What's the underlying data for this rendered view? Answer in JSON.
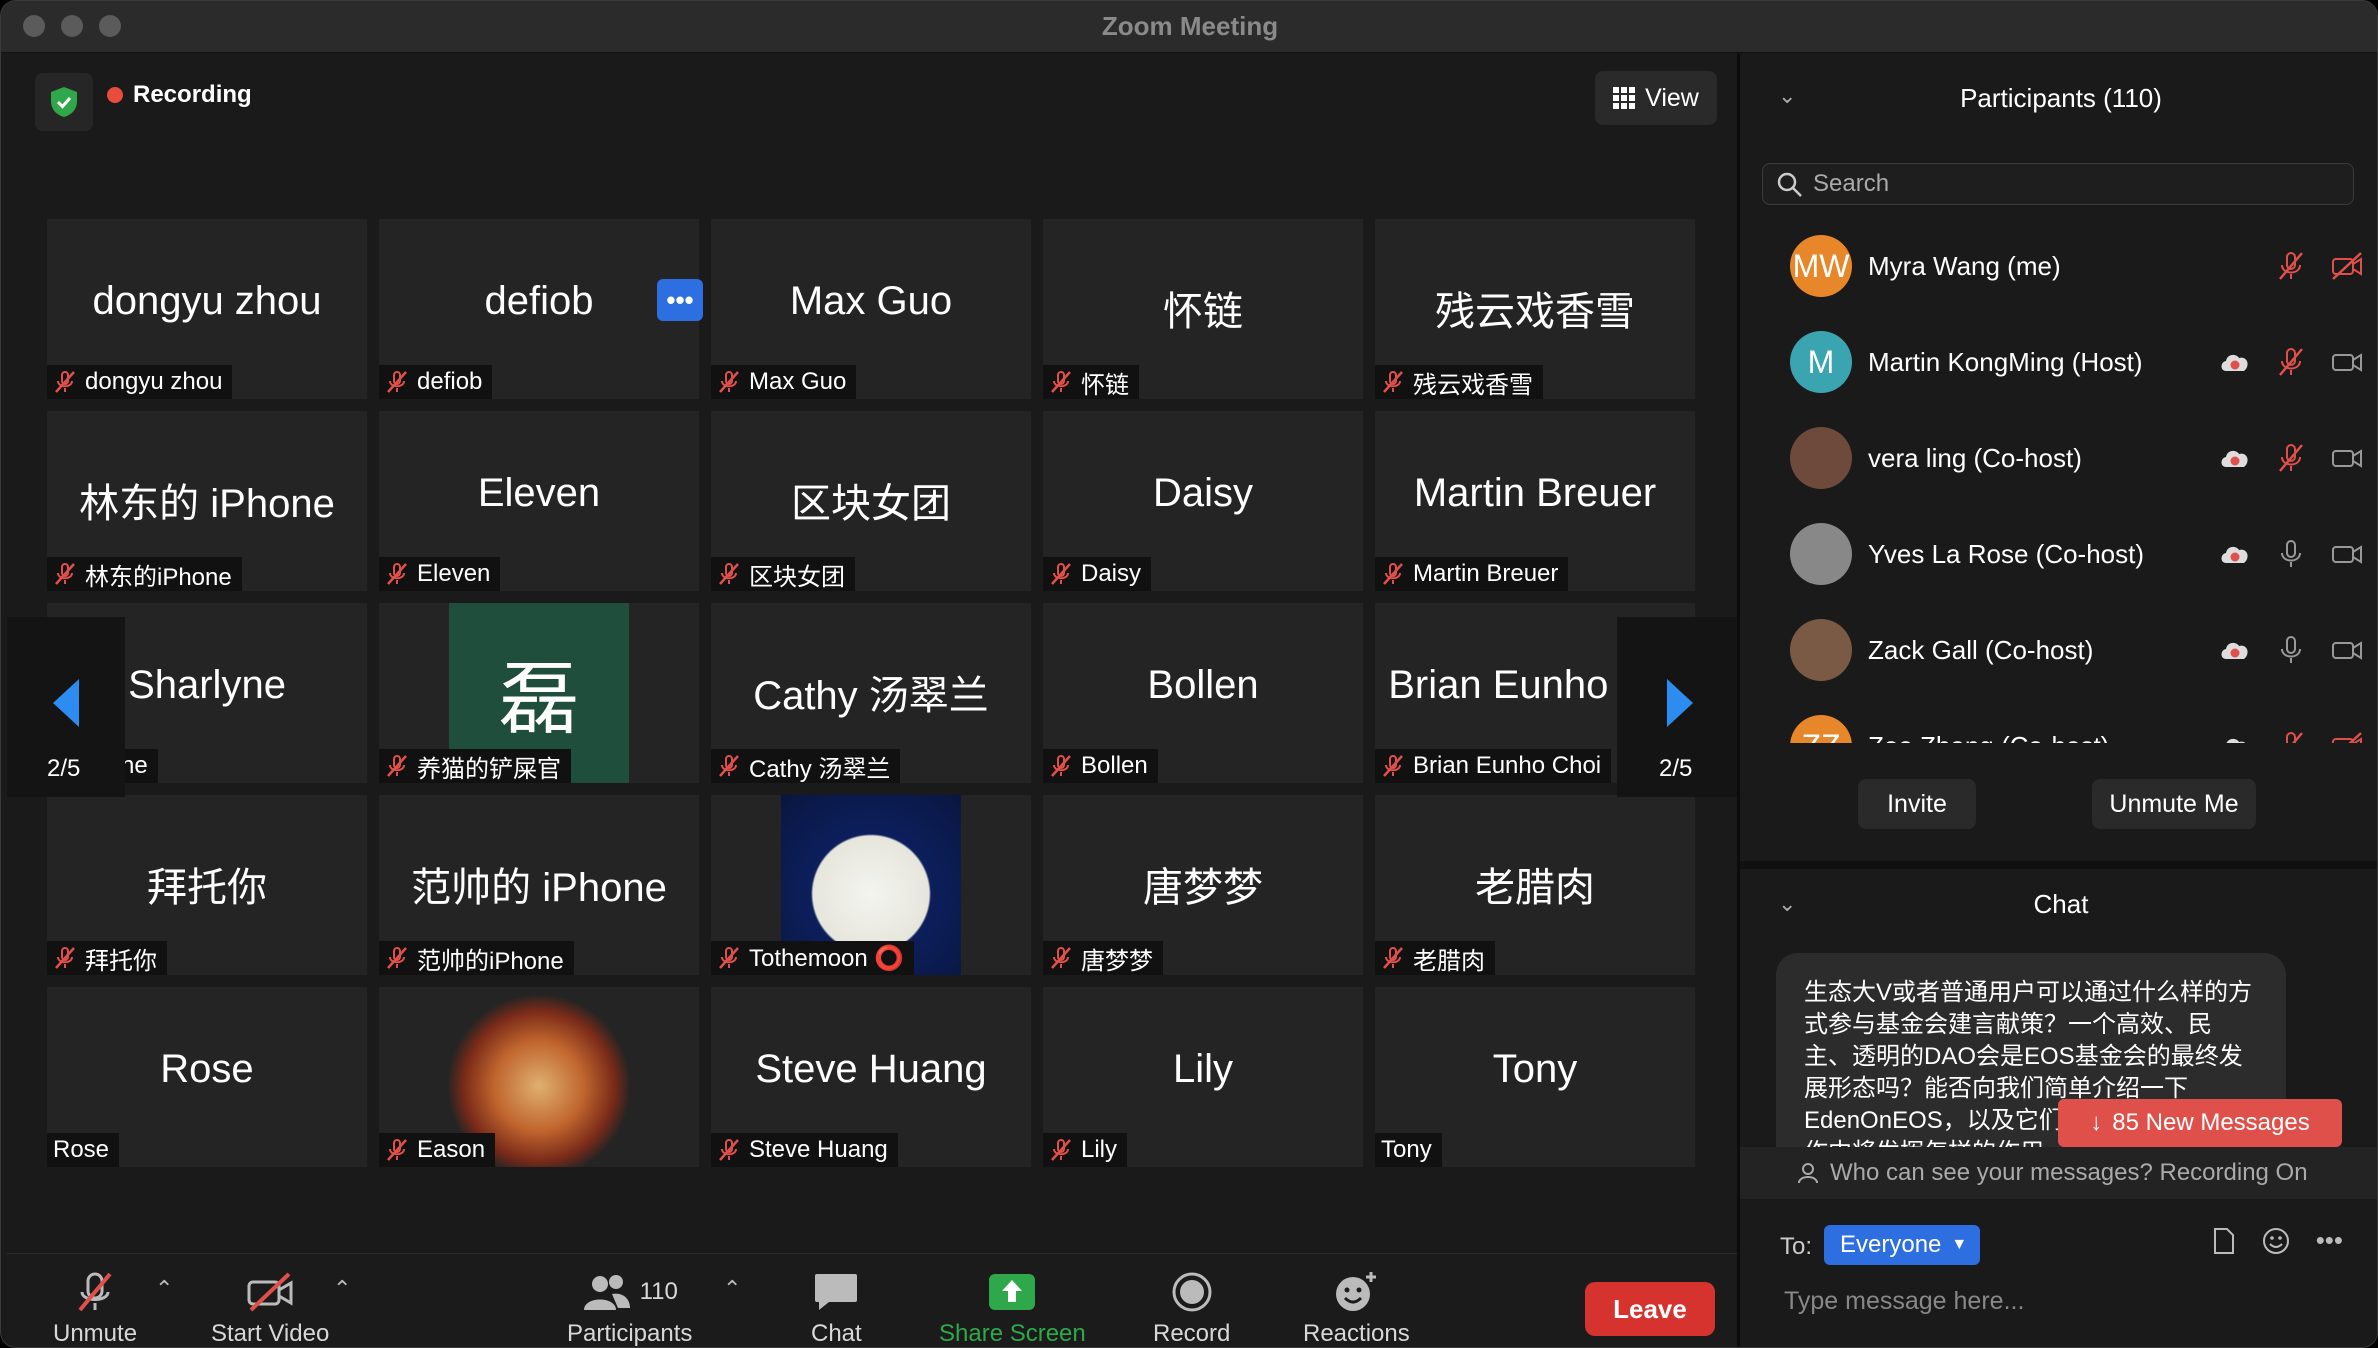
{
  "window": {
    "title": "Zoom Meeting"
  },
  "stage": {
    "recording_label": "Recording",
    "view_label": "View",
    "pager_prev": "2/5",
    "pager_next": "2/5",
    "tiles": [
      {
        "big": "dongyu zhou",
        "tag": "dongyu zhou",
        "muted": true
      },
      {
        "big": "defiob",
        "tag": "defiob",
        "muted": true
      },
      {
        "big": "Max Guo",
        "tag": "Max Guo",
        "muted": true
      },
      {
        "big": "怀链",
        "tag": "怀链",
        "muted": true
      },
      {
        "big": "残云戏香雪",
        "tag": "残云戏香雪",
        "muted": true
      },
      {
        "big": "林东的 iPhone",
        "tag": "林东的iPhone",
        "muted": true
      },
      {
        "big": "Eleven",
        "tag": "Eleven",
        "muted": true
      },
      {
        "big": "区块女团",
        "tag": "区块女团",
        "muted": true
      },
      {
        "big": "Daisy",
        "tag": "Daisy",
        "muted": true
      },
      {
        "big": "Martin Breuer",
        "tag": "Martin Breuer",
        "muted": true
      },
      {
        "big": "Sharlyne",
        "tag": "Sharlyne",
        "muted": false
      },
      {
        "big": "",
        "avatar_text": "磊",
        "tag": "养猫的铲屎官",
        "muted": true
      },
      {
        "big": "Cathy 汤翠兰",
        "tag": "Cathy 汤翠兰",
        "muted": true
      },
      {
        "big": "Bollen",
        "tag": "Bollen",
        "muted": true
      },
      {
        "big": "Brian Eunho C...",
        "tag": "Brian Eunho Choi",
        "muted": true
      },
      {
        "big": "拜托你",
        "tag": "拜托你",
        "muted": true
      },
      {
        "big": "范帅的 iPhone",
        "tag": "范帅的iPhone",
        "muted": true
      },
      {
        "big": "",
        "tag": "Tothemoon ⭕",
        "muted": true
      },
      {
        "big": "唐梦梦",
        "tag": "唐梦梦",
        "muted": true
      },
      {
        "big": "老腊肉",
        "tag": "老腊肉",
        "muted": true
      },
      {
        "big": "Rose",
        "tag": "Rose",
        "muted": false
      },
      {
        "big": "",
        "tag": "Eason",
        "muted": true
      },
      {
        "big": "Steve Huang",
        "tag": "Steve Huang",
        "muted": true
      },
      {
        "big": "Lily",
        "tag": "Lily",
        "muted": true
      },
      {
        "big": "Tony",
        "tag": "Tony",
        "muted": false
      }
    ]
  },
  "toolbar": {
    "unmute": "Unmute",
    "start_video": "Start Video",
    "participants": "Participants",
    "participant_count": "110",
    "chat": "Chat",
    "share_screen": "Share Screen",
    "record": "Record",
    "reactions": "Reactions",
    "leave": "Leave"
  },
  "participants_panel": {
    "title": "Participants (110)",
    "search_placeholder": "Search",
    "people": [
      {
        "initials": "MW",
        "name": "Myra Wang (me)",
        "color": "#e8862a"
      },
      {
        "initials": "M",
        "name": "Martin KongMing (Host)",
        "color": "#3aa4b1"
      },
      {
        "initials": "",
        "name": "vera ling (Co-host)",
        "color": "#6d4a3c"
      },
      {
        "initials": "",
        "name": "Yves La Rose (Co-host)",
        "color": "#888888"
      },
      {
        "initials": "",
        "name": "Zack Gall (Co-host)",
        "color": "#7a5a44"
      },
      {
        "initials": "ZZ",
        "name": "Zoe Zhang (Co-host)",
        "color": "#e8862a"
      }
    ],
    "invite": "Invite",
    "unmute_me": "Unmute Me"
  },
  "chat_panel": {
    "title": "Chat",
    "message": "生态大V或者普通用户可以通过什么样的方式参与基金会建言献策？一个高效、民主、透明的DAO会是EOS基金会的最终发展形态吗？能否向我们简单介绍一下EdenOnEOS，以及它们在EOS基金会的运作中将发挥怎样的作用",
    "new_messages": "85 New Messages",
    "who_can_see": "Who can see your messages? Recording On",
    "to_label": "To:",
    "to_value": "Everyone",
    "placeholder": "Type message here..."
  },
  "colors": {
    "accent": "#2d6ee0",
    "leave": "#d6332f",
    "share": "#2ea84a",
    "mute_red": "#e0504a"
  }
}
